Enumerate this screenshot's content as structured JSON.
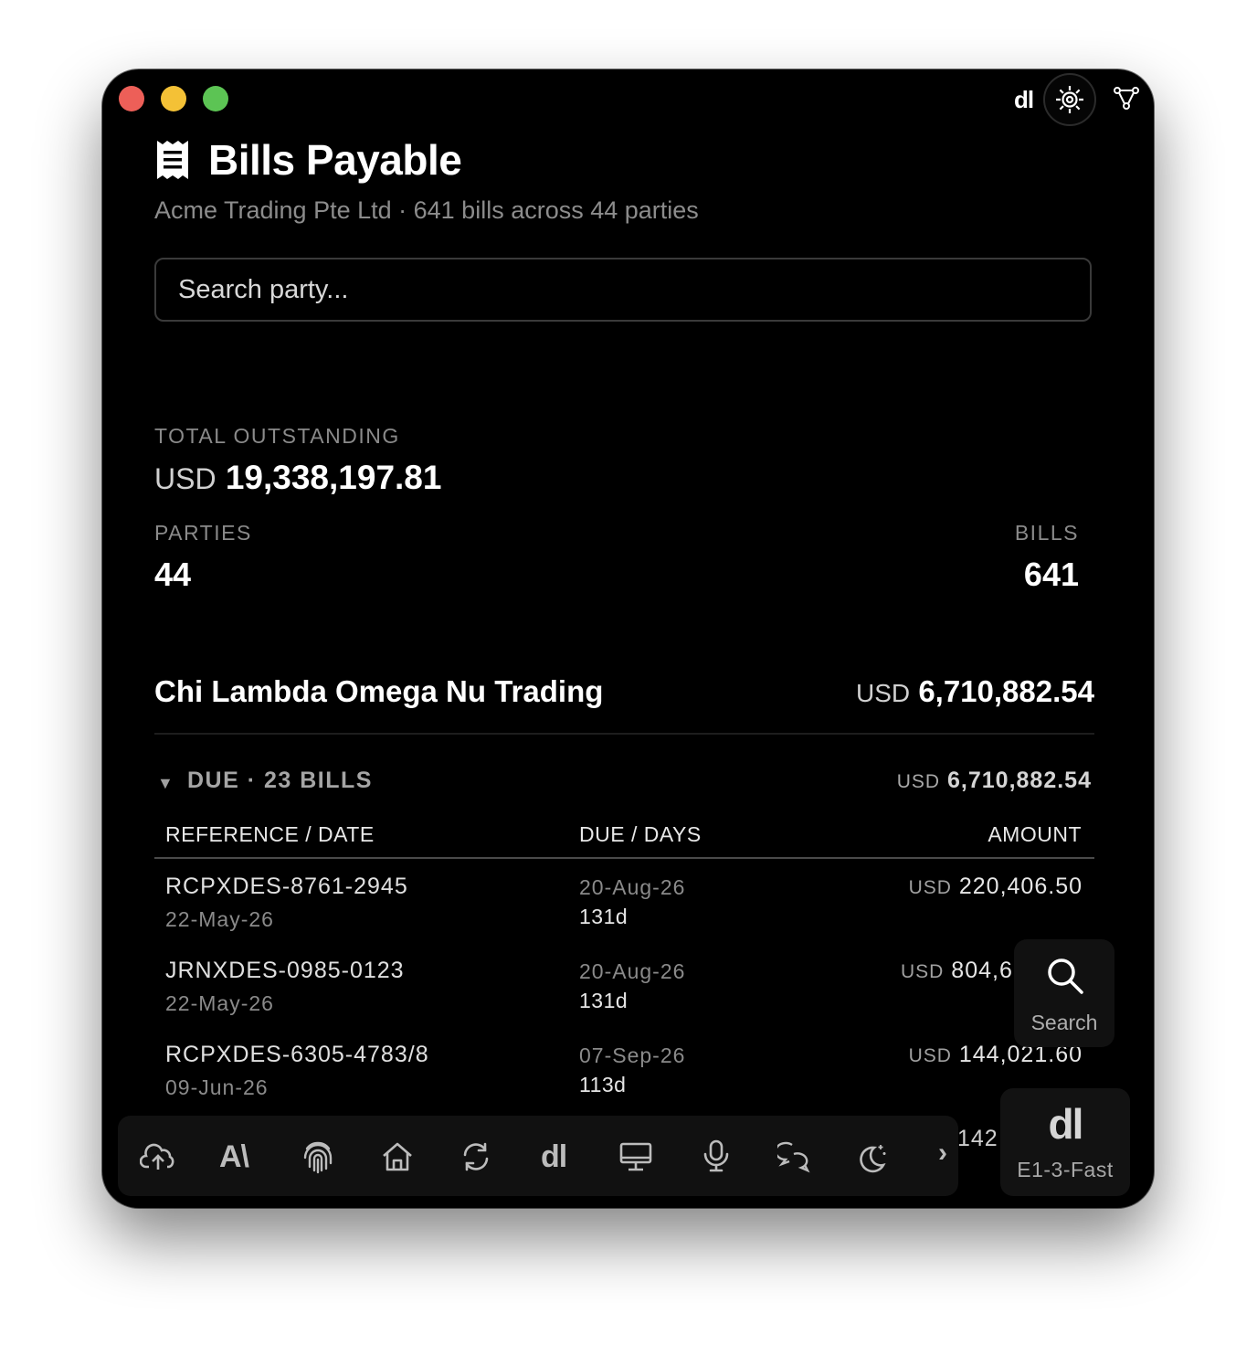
{
  "app": {
    "title": "Bills Payable",
    "subtitle": "Acme Trading Pte Ltd · 641 bills across 44 parties"
  },
  "toolbar": {
    "dl_label": "dl"
  },
  "search": {
    "placeholder": "Search party..."
  },
  "summary": {
    "total_label": "TOTAL OUTSTANDING",
    "currency": "USD",
    "total_value": "19,338,197.81",
    "parties_label": "PARTIES",
    "parties_value": "44",
    "bills_label": "BILLS",
    "bills_value": "641"
  },
  "party": {
    "name": "Chi Lambda Omega Nu Trading",
    "currency": "USD",
    "amount": "6,710,882.54"
  },
  "group": {
    "label": "DUE · 23 BILLS",
    "currency": "USD",
    "amount": "6,710,882.54"
  },
  "table": {
    "headers": [
      "REFERENCE / DATE",
      "DUE / DAYS",
      "AMOUNT"
    ],
    "rows": [
      {
        "ref": "RCPXDES-8761-2945",
        "date": "22-May-26",
        "due": "20-Aug-26",
        "days": "131d",
        "currency": "USD",
        "amount": "220,406.50"
      },
      {
        "ref": "JRNXDES-0985-0123",
        "date": "22-May-26",
        "due": "20-Aug-26",
        "days": "131d",
        "currency": "USD",
        "amount": "804,6"
      },
      {
        "ref": "RCPXDES-6305-4783/8",
        "date": "09-Jun-26",
        "due": "07-Sep-26",
        "days": "113d",
        "currency": "USD",
        "amount": "144,021.60"
      }
    ],
    "clipped_amount": "142,"
  },
  "float_search": {
    "label": "Search"
  },
  "float_model": {
    "icon_text": "dl",
    "label": "E1-3-Fast"
  },
  "dock": {
    "text_font_label": "A\\",
    "dl_label": "dl",
    "more_glyph": "›"
  },
  "colors": {
    "window_bg": "#000000",
    "close": "#ed5f58",
    "minimize": "#f4c136",
    "zoom": "#5cc454",
    "muted_text": "#8a8a8a"
  }
}
